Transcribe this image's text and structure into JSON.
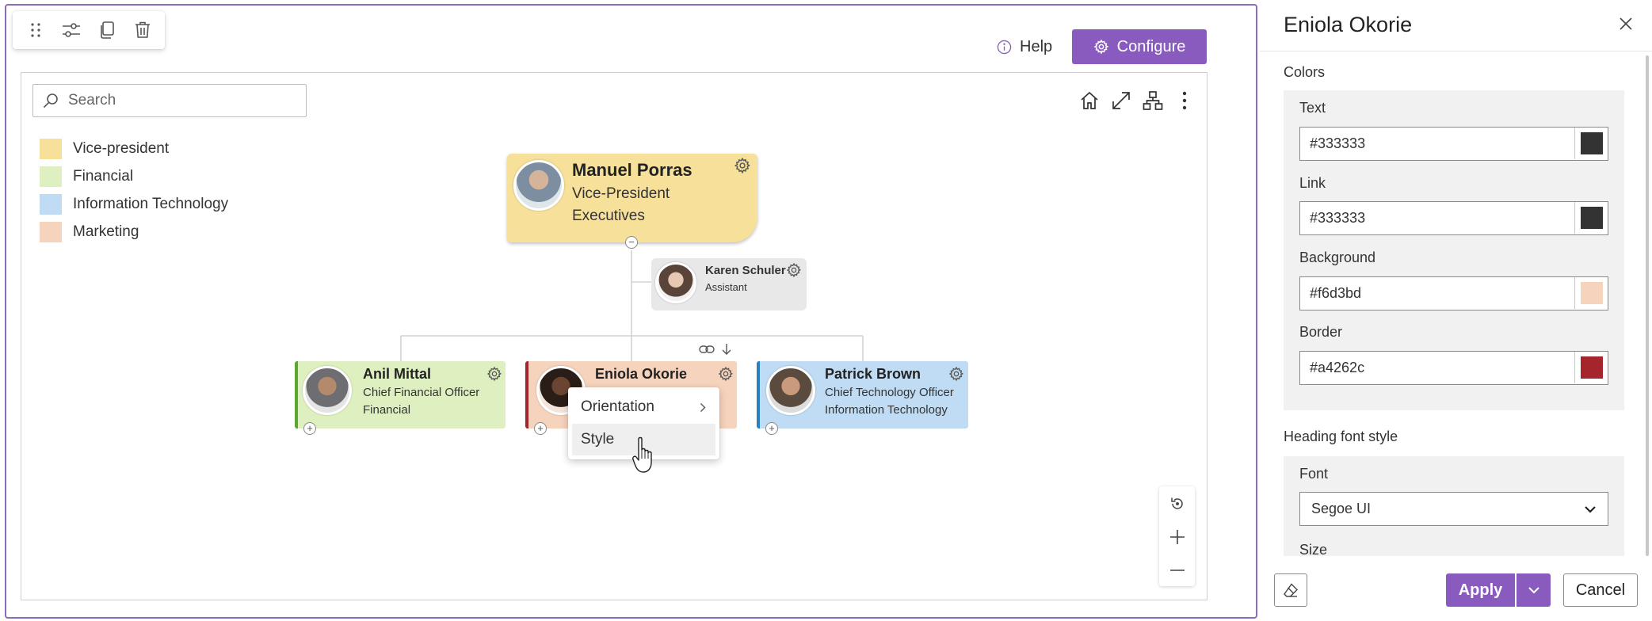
{
  "toolbar": {
    "icons": [
      "drag-handle-icon",
      "settings-sliders-icon",
      "copy-icon",
      "delete-icon"
    ]
  },
  "header": {
    "help_label": "Help",
    "configure_label": "Configure"
  },
  "search": {
    "placeholder": "Search"
  },
  "legend": [
    {
      "label": "Vice-president",
      "color": "#f6e09a"
    },
    {
      "label": "Financial",
      "color": "#dff0c0"
    },
    {
      "label": "Information Technology",
      "color": "#bfdcf4"
    },
    {
      "label": "Marketing",
      "color": "#f6d3bd"
    }
  ],
  "chart_tools": [
    "home-icon",
    "expand-icon",
    "hierarchy-icon",
    "more-icon"
  ],
  "org": {
    "root": {
      "name": "Manuel Porras",
      "title": "Vice-President",
      "department": "Executives",
      "color": "#f6e09a"
    },
    "assistant": {
      "name": "Karen Schuler",
      "title": "Assistant",
      "color": "#e8e8e8"
    },
    "reports": [
      {
        "name": "Anil Mittal",
        "title": "Chief Financial Officer",
        "department": "Financial",
        "color": "#dff0c0",
        "accent": "#5aa832"
      },
      {
        "name": "Eniola Okorie",
        "title": "",
        "department": "",
        "color": "#f6d3bd",
        "accent": "#a4262c"
      },
      {
        "name": "Patrick Brown",
        "title": "Chief Technology Officer",
        "department": "Information Technology",
        "color": "#bfdcf4",
        "accent": "#2a7fc0"
      }
    ]
  },
  "context_menu": {
    "items": [
      {
        "label": "Orientation",
        "has_submenu": true
      },
      {
        "label": "Style",
        "hovered": true
      }
    ]
  },
  "zoom": [
    "reset-view-icon",
    "zoom-in-icon",
    "zoom-out-icon"
  ],
  "panel": {
    "title": "Eniola Okorie",
    "colors_section": "Colors",
    "fields": [
      {
        "label": "Text",
        "value": "#333333",
        "swatch": "#333333"
      },
      {
        "label": "Link",
        "value": "#333333",
        "swatch": "#333333"
      },
      {
        "label": "Background",
        "value": "#f6d3bd",
        "swatch": "#f6d3bd"
      },
      {
        "label": "Border",
        "value": "#a4262c",
        "swatch": "#a4262c"
      }
    ],
    "heading_font_section": "Heading font style",
    "font_label": "Font",
    "font_value": "Segoe UI",
    "size_label": "Size",
    "apply_label": "Apply",
    "cancel_label": "Cancel"
  },
  "theme": {
    "accent": "#8a5bbf",
    "frame": "#8a6bbf"
  }
}
